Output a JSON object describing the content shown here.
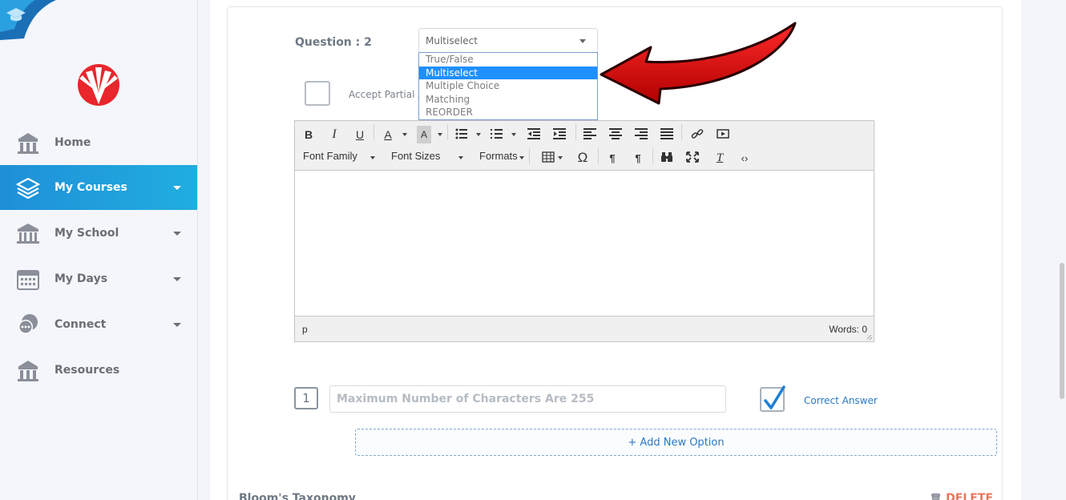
{
  "sidebar": {
    "items": [
      {
        "label": "Home",
        "icon": "school-building-icon",
        "active": false
      },
      {
        "label": "My Courses",
        "icon": "layers-icon",
        "active": true
      },
      {
        "label": "My School",
        "icon": "institution-icon",
        "active": false
      },
      {
        "label": "My Days",
        "icon": "calendar-icon",
        "active": false
      },
      {
        "label": "Connect",
        "icon": "chat-bubbles-icon",
        "active": false
      },
      {
        "label": "Resources",
        "icon": "school-building-icon",
        "active": false
      }
    ]
  },
  "question": {
    "label": "Question : 2",
    "type_select": {
      "value": "Multiselect",
      "options": [
        "True/False",
        "Multiselect",
        "Multiple Choice",
        "Matching",
        "REORDER"
      ],
      "highlighted": "Multiselect"
    },
    "partial_label": "Accept Partial A"
  },
  "editor": {
    "font_family_label": "Font Family",
    "font_sizes_label": "Font Sizes",
    "formats_label": "Formats",
    "status_path": "p",
    "word_count": "Words: 0"
  },
  "option": {
    "number": "1",
    "placeholder": "Maximum Number of Characters Are 255",
    "correct_label": "Correct Answer",
    "correct_checked": true
  },
  "add_option_label": "+ Add New Option",
  "bloom_label": "Bloom's Taxonomy",
  "delete_label": "DELETE",
  "colors": {
    "accent": "#1e90ff",
    "active_nav": "#20aee0",
    "link": "#2a78c5",
    "delete": "#e8755a",
    "arrow": "#d80000"
  }
}
